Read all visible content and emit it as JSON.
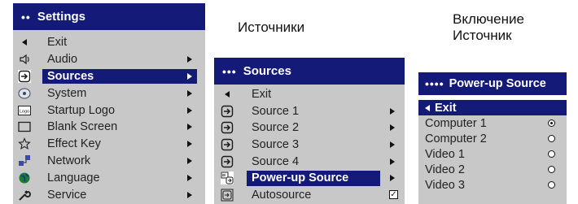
{
  "settings_menu": {
    "title": "Settings",
    "title_dots": "••",
    "items": [
      {
        "label": "Exit",
        "icon": "back-arrow-icon"
      },
      {
        "label": "Audio",
        "icon": "speaker-icon"
      },
      {
        "label": "Sources",
        "icon": "source-icon",
        "selected": true
      },
      {
        "label": "System",
        "icon": "system-icon"
      },
      {
        "label": "Startup Logo",
        "icon": "logo-icon",
        "icon_text": "Logo"
      },
      {
        "label": "Blank Screen",
        "icon": "blank-screen-icon"
      },
      {
        "label": "Effect Key",
        "icon": "star-icon"
      },
      {
        "label": "Network",
        "icon": "network-icon"
      },
      {
        "label": "Language",
        "icon": "globe-icon"
      },
      {
        "label": "Service",
        "icon": "wrench-icon"
      }
    ]
  },
  "sources_caption": "Источники",
  "sources_menu": {
    "title": "Sources",
    "title_dots": "•••",
    "items": [
      {
        "label": "Exit",
        "icon": "back-arrow-icon"
      },
      {
        "label": "Source 1",
        "icon": "source-icon"
      },
      {
        "label": "Source 2",
        "icon": "source-icon"
      },
      {
        "label": "Source 3",
        "icon": "source-icon"
      },
      {
        "label": "Source 4",
        "icon": "source-icon"
      },
      {
        "label": "Power-up Source",
        "icon": "power-up-source-icon",
        "selected": true
      },
      {
        "label": "Autosource",
        "icon": "autosource-icon",
        "checked": true
      }
    ]
  },
  "powerup_caption_line1": "Включение",
  "powerup_caption_line2": "Источник",
  "powerup_menu": {
    "title": "Power-up Source",
    "title_dots": "••••",
    "exit_label": "Exit",
    "items": [
      {
        "label": "Computer 1",
        "checked": true
      },
      {
        "label": "Computer 2",
        "checked": false
      },
      {
        "label": "Video 1",
        "checked": false
      },
      {
        "label": "Video 2",
        "checked": false
      },
      {
        "label": "Video 3",
        "checked": false
      }
    ]
  },
  "colors": {
    "title_bar": "#141a78",
    "panel": "#c8c8c8",
    "highlight": "#141a78"
  }
}
